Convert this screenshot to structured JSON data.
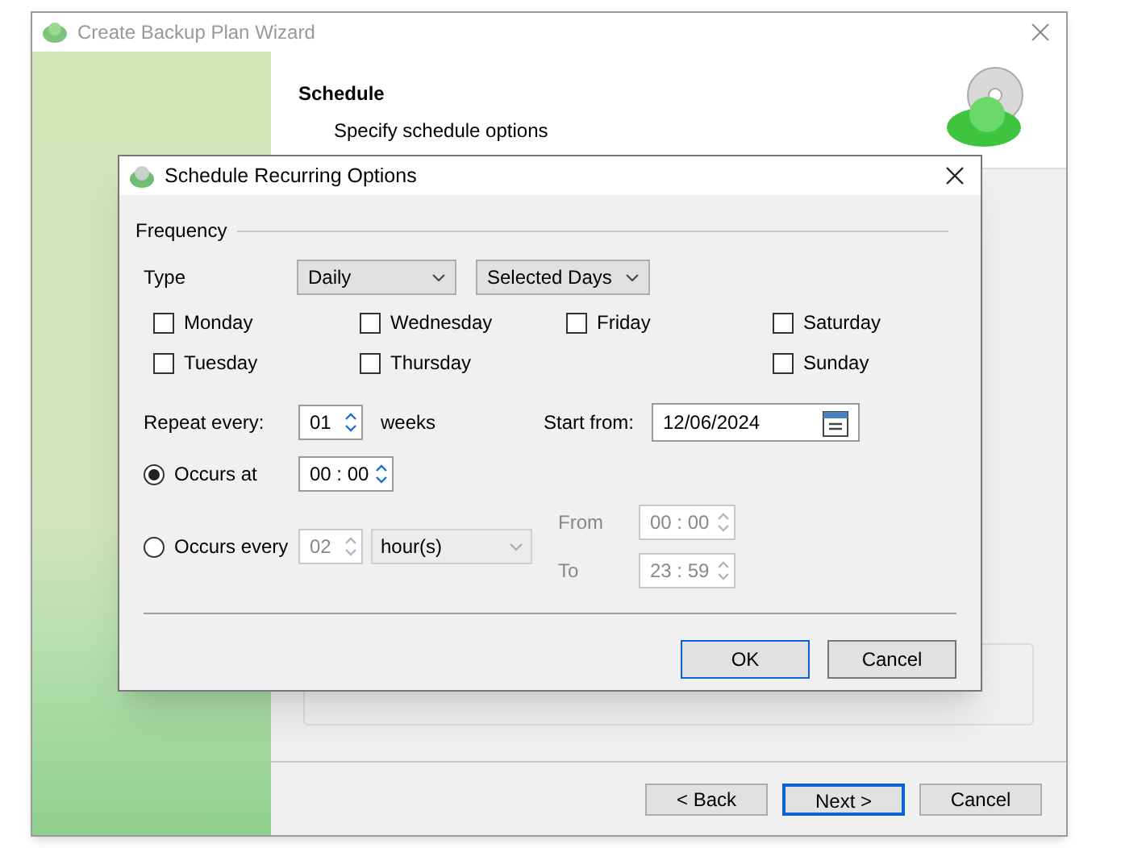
{
  "window": {
    "title": "Create Backup Plan Wizard"
  },
  "header": {
    "title": "Schedule",
    "subtitle": "Specify schedule options"
  },
  "wizard_buttons": [
    {
      "label": "< Back",
      "default": false
    },
    {
      "label": "Next >",
      "default": true
    },
    {
      "label": "Cancel",
      "default": false
    }
  ],
  "dialog": {
    "title": "Schedule Recurring Options",
    "frequency_label": "Frequency",
    "type_label": "Type",
    "type_dropdowns": [
      {
        "value": "Daily"
      },
      {
        "value": "Selected Days"
      }
    ],
    "day_columns": [
      [
        {
          "label": "Monday",
          "checked": false
        },
        {
          "label": "Tuesday",
          "checked": false
        }
      ],
      [
        {
          "label": "Wednesday",
          "checked": false
        },
        {
          "label": "Thursday",
          "checked": false
        }
      ],
      [
        {
          "label": "Friday",
          "checked": false
        }
      ],
      [
        {
          "label": "Saturday",
          "checked": false
        },
        {
          "label": "Sunday",
          "checked": false
        }
      ]
    ],
    "repeat": {
      "label": "Repeat every:",
      "value": "01",
      "unit": "weeks"
    },
    "start": {
      "label": "Start from:",
      "value": "12/06/2024"
    },
    "occurs_at": {
      "label": "Occurs at",
      "selected": true,
      "value": "00 : 00"
    },
    "occurs_every": {
      "label": "Occurs every",
      "selected": false,
      "value": "02",
      "unit": "hour(s)"
    },
    "from": {
      "label": "From",
      "value": "00 : 00"
    },
    "to": {
      "label": "To",
      "value": "23 : 59"
    },
    "buttons": [
      {
        "label": "OK",
        "default": true
      },
      {
        "label": "Cancel",
        "default": false
      }
    ]
  }
}
